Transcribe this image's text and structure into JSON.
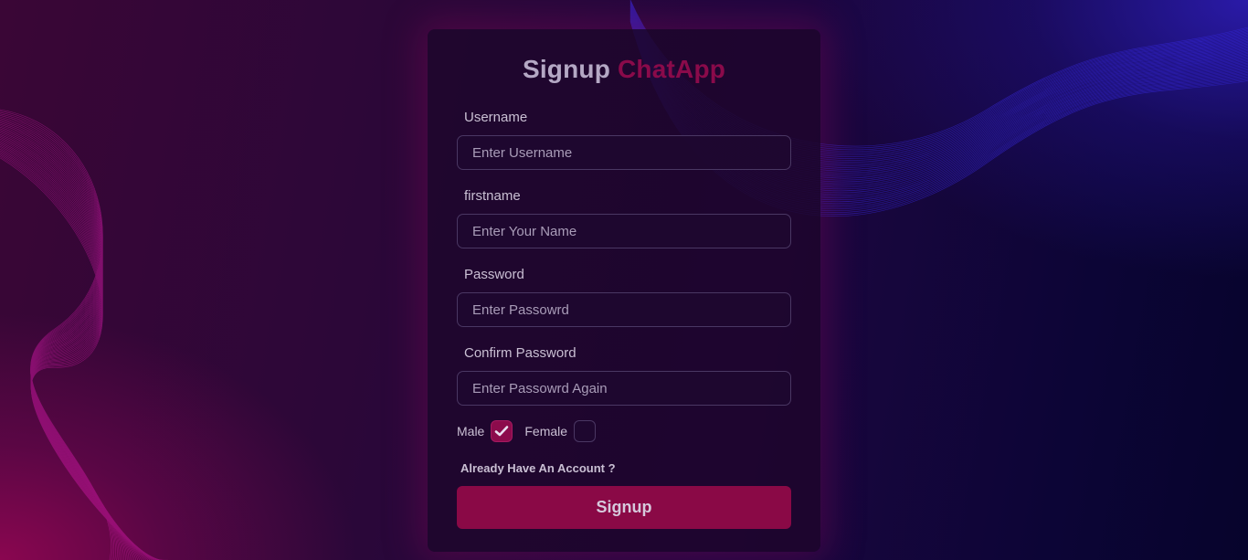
{
  "title": {
    "prefix": "Signup",
    "brand": "ChatApp"
  },
  "fields": [
    {
      "label": "Username",
      "placeholder": "Enter Username",
      "value": ""
    },
    {
      "label": "firstname",
      "placeholder": "Enter Your Name",
      "value": ""
    },
    {
      "label": "Password",
      "placeholder": "Enter Passowrd",
      "value": ""
    },
    {
      "label": "Confirm Password",
      "placeholder": "Enter Passowrd Again",
      "value": ""
    }
  ],
  "gender": {
    "male_label": "Male",
    "male_checked": true,
    "female_label": "Female",
    "female_checked": false
  },
  "account_link": "Already Have An Account ?",
  "signup_button": "Signup",
  "colors": {
    "brand": "#8a0a4a",
    "button": "#8a0946",
    "title_gray": "#b4a8c4"
  },
  "icons": {
    "check": "check-icon"
  }
}
